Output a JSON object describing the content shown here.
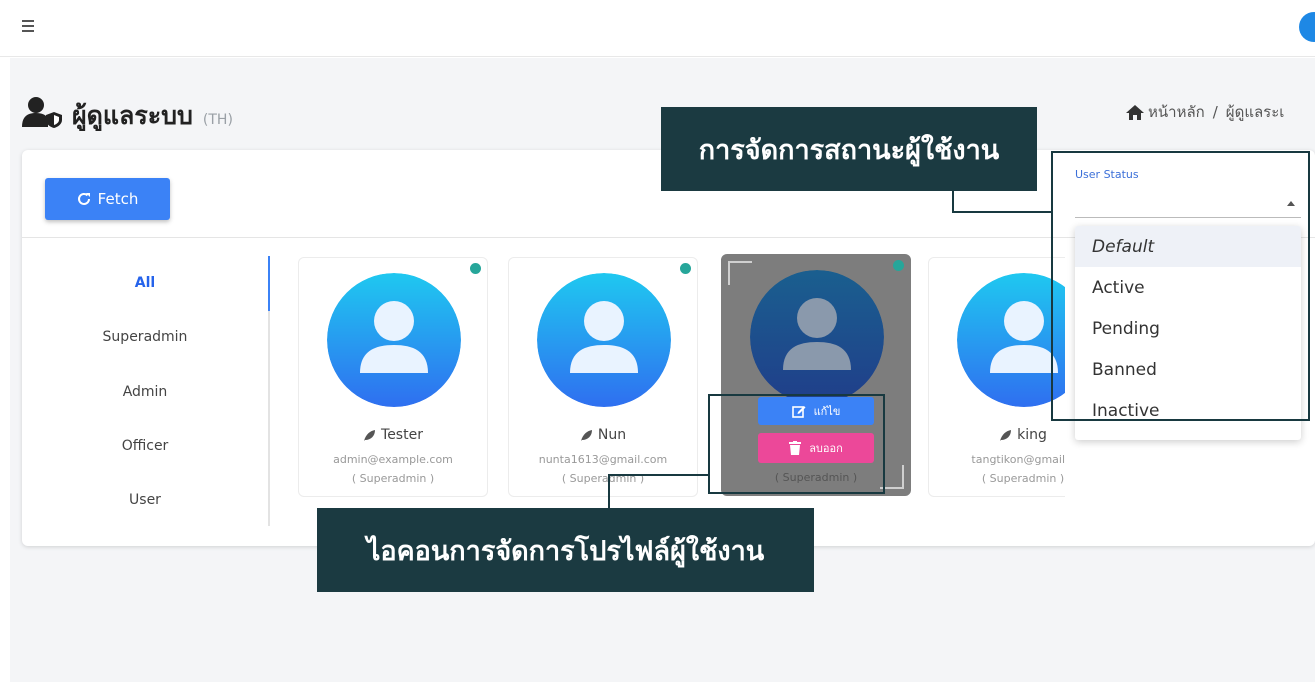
{
  "page": {
    "title": "ผู้ดูแลระบบ",
    "title_sub": "(TH)",
    "breadcrumb_home": "หน้าหลัก",
    "breadcrumb_sep": "/",
    "breadcrumb_current": "ผู้ดูแลระเ"
  },
  "toolbar": {
    "fetch_label": "Fetch"
  },
  "roles": [
    "All",
    "Superadmin",
    "Admin",
    "Officer",
    "User"
  ],
  "users": [
    {
      "name": "Tester",
      "email": "admin@example.com",
      "role": "( Superadmin )"
    },
    {
      "name": "Nun",
      "email": "nunta1613@gmail.com",
      "role": "( Superadmin )"
    },
    {
      "name": "",
      "email": "",
      "role": "( Superadmin )"
    },
    {
      "name": "king",
      "email": "tangtikon@gmail.c",
      "role": "( Superadmin )"
    }
  ],
  "card_actions": {
    "edit_label": "แก้ไข",
    "delete_label": "ลบออก"
  },
  "user_status": {
    "label": "User Status",
    "options": [
      "Default",
      "Active",
      "Pending",
      "Banned",
      "Inactive"
    ],
    "selected": "Default"
  },
  "annotations": {
    "status_callout": "การจัดการสถานะผู้ใช้งาน",
    "profile_callout": "ไอคอนการจัดการโปรไฟล์ผู้ใช้งาน"
  },
  "colors": {
    "primary": "#3b82f6",
    "delete": "#ec4899",
    "online": "#26a69a",
    "annotation": "#1b3a41"
  }
}
